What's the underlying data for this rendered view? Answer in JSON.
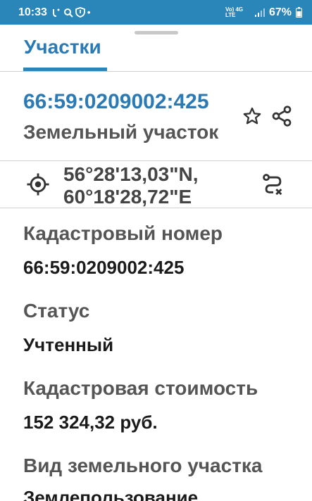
{
  "status_bar": {
    "time": "10:33",
    "network_small": "Vo) 4G LTE",
    "battery": "67%"
  },
  "tabs": [
    {
      "label": "Участки"
    }
  ],
  "parcel": {
    "cadastral_number": "66:59:0209002:425",
    "object_type": "Земельный участок",
    "coords_line1": "56°28'13,03\"N,",
    "coords_line2": "60°18'28,72\"E"
  },
  "fields": [
    {
      "label": "Кадастровый номер",
      "value": "66:59:0209002:425"
    },
    {
      "label": "Статус",
      "value": "Учтенный"
    },
    {
      "label": "Кадастровая стоимость",
      "value": "152 324,32 руб."
    },
    {
      "label": "Вид земельного участка",
      "value": "Землепользование"
    }
  ],
  "colors": {
    "accent": "#2a85b8",
    "title_blue": "#2a7ab5"
  },
  "icons": [
    "star-icon",
    "share-icon",
    "locate-icon",
    "route-remove-icon"
  ]
}
